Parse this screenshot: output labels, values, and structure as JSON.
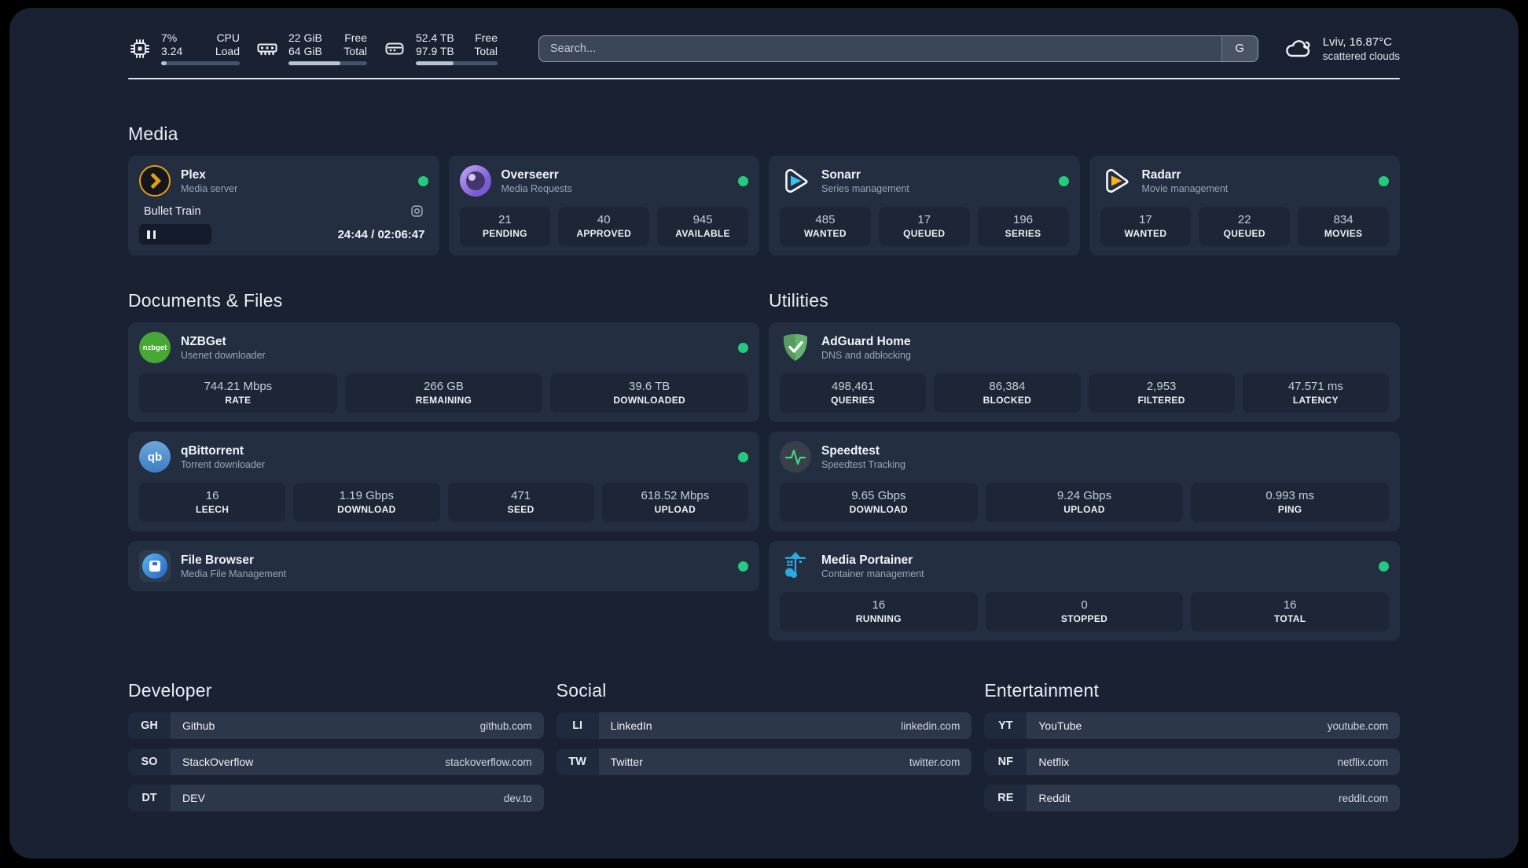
{
  "system": {
    "cpu": {
      "value1": "7%",
      "label1": "CPU",
      "value2": "3.24",
      "label2": "Load",
      "progress_pct": 7
    },
    "memory": {
      "value1": "22 GiB",
      "label1": "Free",
      "value2": "64 GiB",
      "label2": "Total",
      "progress_pct": 66
    },
    "disk": {
      "value1": "52.4 TB",
      "label1": "Free",
      "value2": "97.9 TB",
      "label2": "Total",
      "progress_pct": 46
    }
  },
  "search": {
    "placeholder": "Search...",
    "button_label": "G"
  },
  "weather": {
    "line1": "Lviv, 16.87°C",
    "line2": "scattered clouds"
  },
  "sections": {
    "media": "Media",
    "documents": "Documents & Files",
    "utilities": "Utilities",
    "developer": "Developer",
    "social": "Social",
    "entertainment": "Entertainment"
  },
  "apps": {
    "plex": {
      "name": "Plex",
      "description": "Media server",
      "status": "online",
      "now_playing": "Bullet Train",
      "time_display": "24:44 / 02:06:47"
    },
    "overseerr": {
      "name": "Overseerr",
      "description": "Media Requests",
      "status": "online",
      "stats": [
        {
          "value": "21",
          "label": "PENDING"
        },
        {
          "value": "40",
          "label": "APPROVED"
        },
        {
          "value": "945",
          "label": "AVAILABLE"
        }
      ]
    },
    "sonarr": {
      "name": "Sonarr",
      "description": "Series management",
      "status": "online",
      "stats": [
        {
          "value": "485",
          "label": "WANTED"
        },
        {
          "value": "17",
          "label": "QUEUED"
        },
        {
          "value": "196",
          "label": "SERIES"
        }
      ]
    },
    "radarr": {
      "name": "Radarr",
      "description": "Movie management",
      "status": "online",
      "stats": [
        {
          "value": "17",
          "label": "WANTED"
        },
        {
          "value": "22",
          "label": "QUEUED"
        },
        {
          "value": "834",
          "label": "MOVIES"
        }
      ]
    },
    "nzbget": {
      "name": "NZBGet",
      "description": "Usenet downloader",
      "status": "online",
      "icon_text": "nzbget",
      "stats": [
        {
          "value": "744.21 Mbps",
          "label": "RATE"
        },
        {
          "value": "266 GB",
          "label": "REMAINING"
        },
        {
          "value": "39.6 TB",
          "label": "DOWNLOADED"
        }
      ]
    },
    "qbittorrent": {
      "name": "qBittorrent",
      "description": "Torrent downloader",
      "status": "online",
      "icon_text": "qb",
      "stats": [
        {
          "value": "16",
          "label": "LEECH"
        },
        {
          "value": "1.19 Gbps",
          "label": "DOWNLOAD"
        },
        {
          "value": "471",
          "label": "SEED"
        },
        {
          "value": "618.52 Mbps",
          "label": "UPLOAD"
        }
      ]
    },
    "filebrowser": {
      "name": "File Browser",
      "description": "Media File Management",
      "status": "online"
    },
    "adguard": {
      "name": "AdGuard Home",
      "description": "DNS and adblocking",
      "stats": [
        {
          "value": "498,461",
          "label": "QUERIES"
        },
        {
          "value": "86,384",
          "label": "BLOCKED"
        },
        {
          "value": "2,953",
          "label": "FILTERED"
        },
        {
          "value": "47.571 ms",
          "label": "LATENCY"
        }
      ]
    },
    "speedtest": {
      "name": "Speedtest",
      "description": "Speedtest Tracking",
      "stats": [
        {
          "value": "9.65 Gbps",
          "label": "DOWNLOAD"
        },
        {
          "value": "9.24 Gbps",
          "label": "UPLOAD"
        },
        {
          "value": "0.993 ms",
          "label": "PING"
        }
      ]
    },
    "portainer": {
      "name": "Media Portainer",
      "description": "Container management",
      "status": "online",
      "stats": [
        {
          "value": "16",
          "label": "RUNNING"
        },
        {
          "value": "0",
          "label": "STOPPED"
        },
        {
          "value": "16",
          "label": "TOTAL"
        }
      ]
    }
  },
  "links": {
    "developer": [
      {
        "tag": "GH",
        "name": "Github",
        "url": "github.com"
      },
      {
        "tag": "SO",
        "name": "StackOverflow",
        "url": "stackoverflow.com"
      },
      {
        "tag": "DT",
        "name": "DEV",
        "url": "dev.to"
      }
    ],
    "social": [
      {
        "tag": "LI",
        "name": "LinkedIn",
        "url": "linkedin.com"
      },
      {
        "tag": "TW",
        "name": "Twitter",
        "url": "twitter.com"
      }
    ],
    "entertainment": [
      {
        "tag": "YT",
        "name": "YouTube",
        "url": "youtube.com"
      },
      {
        "tag": "NF",
        "name": "Netflix",
        "url": "netflix.com"
      },
      {
        "tag": "RE",
        "name": "Reddit",
        "url": "reddit.com"
      }
    ]
  },
  "colors": {
    "status_online": "#27c880",
    "plex_orange": "#e5a00d",
    "sonarr_blue": "#38c1f1",
    "radarr_yellow": "#ffb31a",
    "nzbget_green": "#47a835",
    "qbittorrent_blue": "#4b8fd4",
    "adguard_green": "#63b56d",
    "speedtest_green": "#3fd687",
    "portainer_blue": "#29abe2",
    "page_background": "#192132",
    "card_background": "#242e41"
  }
}
